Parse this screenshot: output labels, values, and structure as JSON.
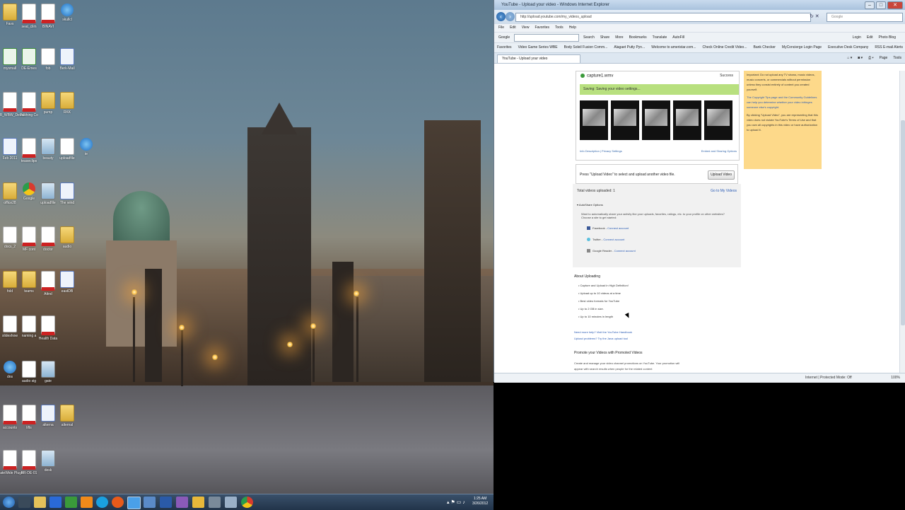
{
  "desktop": {
    "icons": [
      {
        "label": "Favs",
        "kind": "folder"
      },
      {
        "label": "seat_clim",
        "kind": "pdf"
      },
      {
        "label": "BINAVI",
        "kind": "pdf"
      },
      {
        "label": "skullcl",
        "kind": "ie"
      },
      {
        "label": "mysmall",
        "kind": "excel"
      },
      {
        "label": "DE-Emes",
        "kind": "excel"
      },
      {
        "label": "fob",
        "kind": "doc"
      },
      {
        "label": "Berk-Mail",
        "kind": "word"
      },
      {
        "label": "MBR_WBW_DetailFlyer",
        "kind": "pdf"
      },
      {
        "label": "Pushing Co",
        "kind": "pdf"
      },
      {
        "label": "pump",
        "kind": "folder"
      },
      {
        "label": "RKK",
        "kind": "folder"
      },
      {
        "label": "Feb 2011",
        "kind": "word"
      },
      {
        "label": "teaseclips",
        "kind": "pdf"
      },
      {
        "label": "beauty",
        "kind": "img"
      },
      {
        "label": "uploadfile",
        "kind": "doc"
      },
      {
        "label": "ie",
        "kind": "ie"
      },
      {
        "label": "office28",
        "kind": "folder"
      },
      {
        "label": "Google",
        "kind": "chrome"
      },
      {
        "label": "uploadfile",
        "kind": "img"
      },
      {
        "label": "The wind",
        "kind": "word"
      },
      {
        "label": "docs_2",
        "kind": "doc"
      },
      {
        "label": "MF cont",
        "kind": "pdf"
      },
      {
        "label": "doctor",
        "kind": "pdf"
      },
      {
        "label": "audio",
        "kind": "folder"
      },
      {
        "label": "fold",
        "kind": "folder"
      },
      {
        "label": "teams",
        "kind": "folder"
      },
      {
        "label": "Attnd",
        "kind": "pdf"
      },
      {
        "label": "eastDB",
        "kind": "word"
      },
      {
        "label": "slideshow",
        "kind": "doc"
      },
      {
        "label": "naming a",
        "kind": "doc"
      },
      {
        "label": "Health Data",
        "kind": "pdf"
      },
      {
        "label": "dns",
        "kind": "ie"
      },
      {
        "label": "audio sig",
        "kind": "doc"
      },
      {
        "label": "gate",
        "kind": "img"
      },
      {
        "label": "accounts",
        "kind": "pdf"
      },
      {
        "label": "lifts",
        "kind": "pdf"
      },
      {
        "label": "alterna",
        "kind": "word"
      },
      {
        "label": "alternal",
        "kind": "folder"
      },
      {
        "label": "StateWide Plugs",
        "kind": "pdf"
      },
      {
        "label": "BR-DE-01",
        "kind": "pdf"
      },
      {
        "label": "desk",
        "kind": "img"
      }
    ]
  },
  "taskbar": {
    "clock_time": "1:25 AM",
    "clock_date": "3/26/2012"
  },
  "browser": {
    "title": "YouTube - Upload your video - Windows Internet Explorer",
    "address": "http://upload.youtube.com/my_videos_upload",
    "search_placeholder": "Google",
    "menu": [
      "File",
      "Edit",
      "View",
      "Favorites",
      "Tools",
      "Help"
    ],
    "google_bar": {
      "label": "Google",
      "items": [
        "Search",
        "Share",
        "More",
        "Bookmarks",
        "Translate",
        "AutoFill"
      ],
      "right": [
        "Login",
        "Edit",
        "Photo Blog"
      ]
    },
    "favorites": [
      "Favorites",
      "Video Game Series WBE",
      "Body Soleil Fusion Comm...",
      "Alagaet Putty Pyn...",
      "Welcome to ameristar.com...",
      "Check Online Credit Video...",
      "Bank Checker",
      "MyConcierge Login Page",
      "Executive Desk Company",
      "RSS E-mail Alerts"
    ],
    "tab_label": "YouTube - Upload your video",
    "cmd": [
      "Page",
      "Tools"
    ],
    "status": {
      "zone": "Internet | Protected Mode: Off",
      "zoom": "100%"
    }
  },
  "upload": {
    "filename": "capture1.wmv",
    "success_label": "Success",
    "progress_text": "Saving: Saving your video settings...",
    "thumbnail_count": 5,
    "links_left": "Info  Description | Privacy Settings",
    "links_right": "Embed and Sharing Options",
    "press_text": "Press \"Upload Video\" to select and upload another video file.",
    "upload_button": "Upload Video",
    "total_uploaded": "Total videos uploaded: 1",
    "go_to_my_videos": "Go to My Videos",
    "autoshare_title": "AutoShare Options",
    "autoshare_desc": "Want to automatically share your activity like your uploads, favorites, ratings, etc. to your profile on other websites? Choose a site to get started:",
    "sites": [
      {
        "name": "Facebook",
        "action": "Connect account",
        "color": "#3b5998"
      },
      {
        "name": "Twitter",
        "action": "Connect account",
        "color": "#5bc0de"
      },
      {
        "name": "Google Reader",
        "action": "Connect account",
        "color": "#888888"
      }
    ],
    "about_title": "About Uploading",
    "about_items": [
      "Capture and Upload in High Definition!",
      "Upload up to 10 videos at a time",
      "Best video formats for YouTube",
      "Up to 2 GB in size.",
      "Up to 10 minutes in length"
    ],
    "help_line1": "Need more help? Visit the YouTube Handbook",
    "help_line2": "Upload problems? Try the Java upload tool",
    "promote_title": "Promote your Videos with Promoted Videos",
    "promote_text": "Create and manage your video channel promotions on YouTube. Your promotion will appear with search results when people for the related content",
    "sidebar_text1": "Important: Do not upload any TV shows, music videos, music concerts, or commercials without permission unless they consist entirely of content you created yourself.",
    "sidebar_text2": "The Copyright Tips page and the Community Guidelines can help you determine whether your video infringes someone else's copyright.",
    "sidebar_text3": "By clicking \"Upload Video\", you are representing that this video does not violate YouTube's Terms of Use and that you own all copyrights in this video or have authorization to upload it."
  }
}
